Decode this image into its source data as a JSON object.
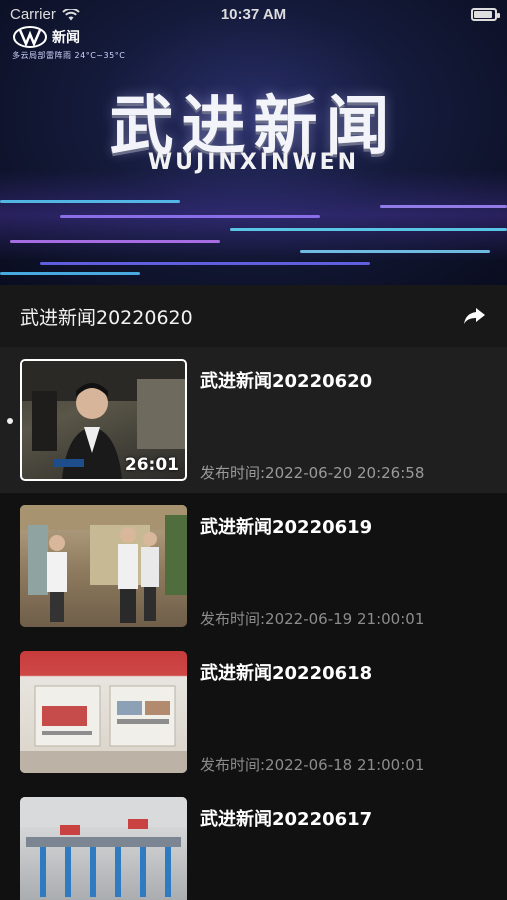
{
  "status_bar": {
    "carrier": "Carrier",
    "time": "10:37 AM",
    "battery_level": 0.9
  },
  "video": {
    "channel_name": "新闻",
    "channel_subtitle": "多云局部雷阵雨  24°C~35°C",
    "title_cn": "武进新闻",
    "title_pinyin": "WUJINXINWEN"
  },
  "header": {
    "title": "武进新闻20220620",
    "share_icon": "share-icon"
  },
  "episodes": [
    {
      "title": "武进新闻20220620",
      "date": "发布时间:2022-06-20 20:26:58",
      "duration": "26:01",
      "active": true
    },
    {
      "title": "武进新闻20220619",
      "date": "发布时间:2022-06-19 21:00:01",
      "duration": "",
      "active": false
    },
    {
      "title": "武进新闻20220618",
      "date": "发布时间:2022-06-18 21:00:01",
      "duration": "",
      "active": false
    },
    {
      "title": "武进新闻20220617",
      "date": "",
      "duration": "",
      "active": false
    }
  ]
}
